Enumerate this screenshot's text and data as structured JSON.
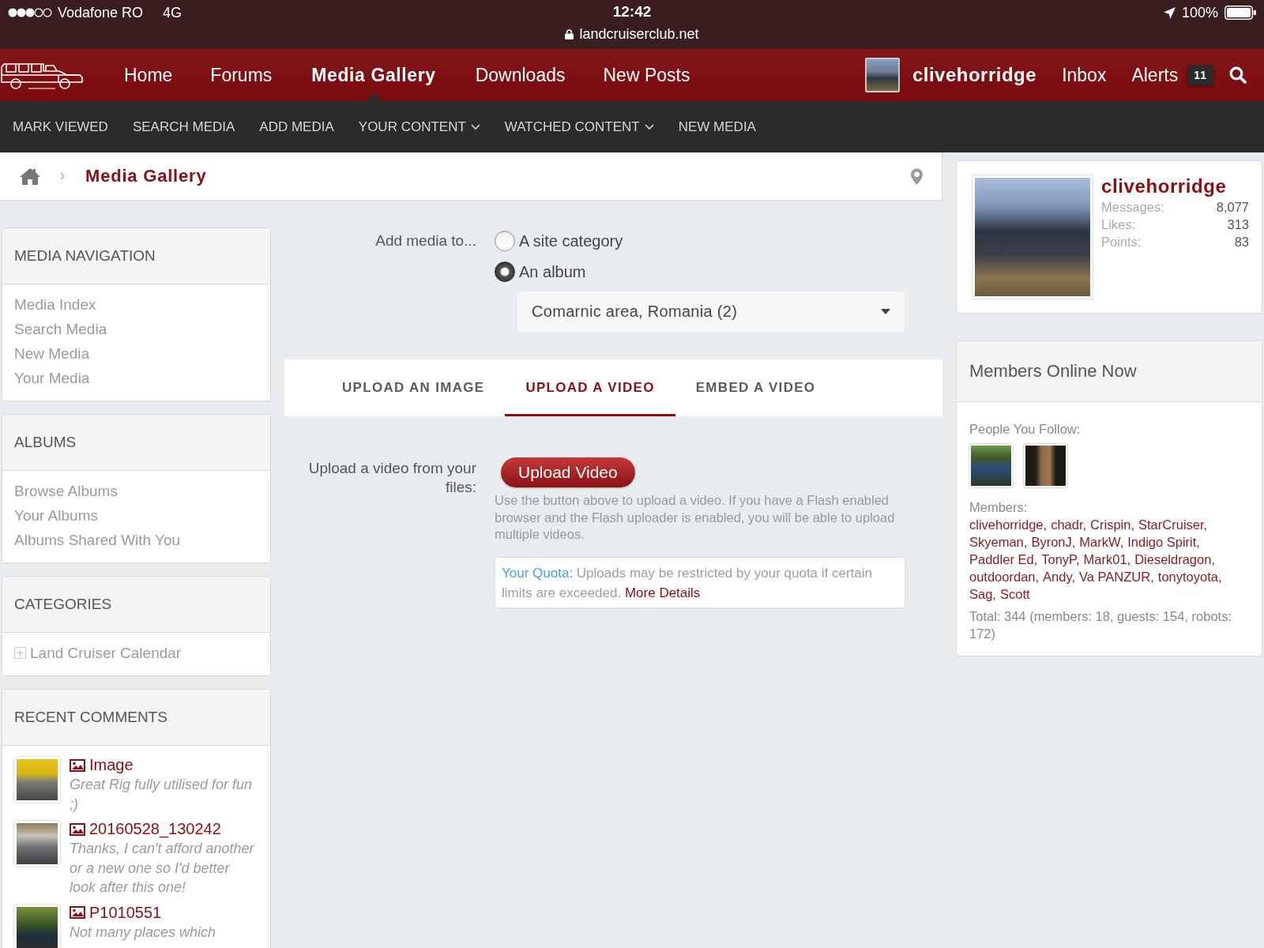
{
  "status_bar": {
    "carrier": "Vodafone RO",
    "network": "4G",
    "time": "12:42",
    "url": "landcruiserclub.net",
    "battery": "100%"
  },
  "nav": {
    "items": [
      {
        "label": "Home",
        "selected": false
      },
      {
        "label": "Forums",
        "selected": false
      },
      {
        "label": "Media Gallery",
        "selected": true
      },
      {
        "label": "Downloads",
        "selected": false
      },
      {
        "label": "New Posts",
        "selected": false
      }
    ],
    "user": "clivehorridge",
    "inbox": "Inbox",
    "alerts": {
      "label": "Alerts",
      "count": "11"
    }
  },
  "subnav": [
    {
      "label": "MARK VIEWED",
      "dropdown": false
    },
    {
      "label": "SEARCH MEDIA",
      "dropdown": false
    },
    {
      "label": "ADD MEDIA",
      "dropdown": false
    },
    {
      "label": "YOUR CONTENT",
      "dropdown": true
    },
    {
      "label": "WATCHED CONTENT",
      "dropdown": true
    },
    {
      "label": "NEW MEDIA",
      "dropdown": false
    }
  ],
  "breadcrumb": {
    "current": "Media Gallery"
  },
  "sidebar": {
    "panels": [
      {
        "kind": "links",
        "title": "MEDIA NAVIGATION",
        "items": [
          "Media Index",
          "Search Media",
          "New Media",
          "Your Media"
        ]
      },
      {
        "kind": "links",
        "title": "ALBUMS",
        "items": [
          "Browse Albums",
          "Your Albums",
          "Albums Shared With You"
        ]
      },
      {
        "kind": "tree",
        "title": "CATEGORIES",
        "items": [
          {
            "label": "Land Cruiser Calendar",
            "expanded": false
          }
        ]
      },
      {
        "kind": "comments",
        "title": "RECENT COMMENTS",
        "items": [
          {
            "title": "Image",
            "comment": "Great Rig fully utilised for fun ;)"
          },
          {
            "title": "20160528_130242",
            "comment": "Thanks, I can't afford another or a new one so I'd better look after this one!"
          },
          {
            "title": "P1010551",
            "comment": "Not many places which"
          }
        ]
      }
    ]
  },
  "form": {
    "label": "Add media to...",
    "options": [
      {
        "label": "A site category",
        "selected": false
      },
      {
        "label": "An album",
        "selected": true
      }
    ],
    "album": {
      "value": "Comarnic area, Romania (2)"
    }
  },
  "tabs": [
    {
      "label": "UPLOAD AN IMAGE",
      "selected": false
    },
    {
      "label": "UPLOAD A VIDEO",
      "selected": true
    },
    {
      "label": "EMBED A VIDEO",
      "selected": false
    }
  ],
  "upload": {
    "label": "Upload a video from your files:",
    "button": "Upload Video",
    "help": "Use the button above to upload a video. If you have a Flash enabled browser and the Flash uploader is enabled, you will be able to upload multiple videos.",
    "quota": {
      "label": "Your Quota:",
      "text": "Uploads may be restricted by your quota if certain limits are exceeded.",
      "link": "More Details"
    }
  },
  "profile": {
    "name": "clivehorridge",
    "stats": [
      {
        "label": "Messages:",
        "value": "8,077"
      },
      {
        "label": "Likes:",
        "value": "313"
      },
      {
        "label": "Points:",
        "value": "83"
      }
    ]
  },
  "members_online": {
    "title": "Members Online Now",
    "following_label": "People You Follow:",
    "members_label": "Members:",
    "members": [
      "clivehorridge,",
      "chadr,",
      "Crispin,",
      "StarCruiser,",
      "Skyeman,",
      "ByronJ,",
      "MarkW,",
      "Indigo Spirit,",
      "Paddler Ed,",
      "TonyP,",
      "Mark01,",
      "Dieseldragon,",
      "outdoordan,",
      "Andy,",
      "Va PANZUR,",
      "tonytoyota,",
      "Sag,",
      "Scott"
    ],
    "total": "Total: 344 (members: 18, guests: 154, robots: 172)"
  }
}
